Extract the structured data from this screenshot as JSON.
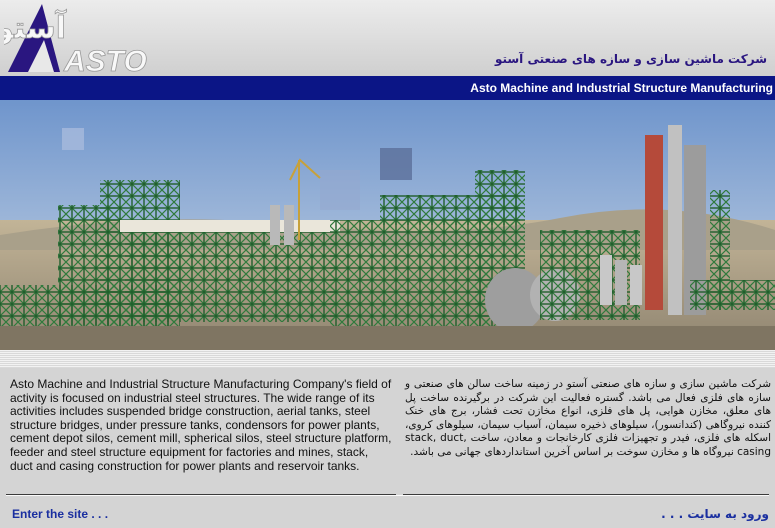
{
  "header": {
    "logo_text_fa": "آستو",
    "logo_text_en": "ASTO",
    "title_fa": "شرکت ماشین سازی و سازه های صنعتی آستو",
    "title_en": "Asto Machine and Industrial Structure Manufacturing"
  },
  "content": {
    "description_en": "Asto Machine and Industrial Structure Manufacturing Company's field of activity is focused on industrial steel structures. The wide range of its activities includes suspended bridge construction, aerial tanks, steel structure bridges, under pressure tanks, condensors for power plants, cement depot silos, cement mill, spherical silos, steel structure platform, feeder and steel structure equipment for factories and mines, stack, duct and casing construction for power plants and reservoir tanks.",
    "description_fa": "شرکت ماشین سازی و سازه های صنعتی آستو در زمینه ساخت سالن های صنعتی و سازه های فلزی فعال می باشد. گستره فعالیت این شرکت در برگیرنده ساخت پل های معلق، مخازن هوایی، پل های فلزی، انواع مخازن تحت فشار، برج های خنک کننده نیروگاهی (کندانسور)، سیلوهای ذخیره سیمان، آسیاب سیمان، سیلوهای کروی، اسکله های فلزی، فیدر و تجهیزات فلزی کارخانجات و معادن، ساخت stack, duct, casing نیروگاه ها و مخازن سوخت بر اساس آخرین استانداردهای جهانی می باشد."
  },
  "footer": {
    "enter_en": "Enter the site . . .",
    "enter_fa": "ورود به سایت . . ."
  },
  "colors": {
    "brand_navy": "#0b1586",
    "title_purple": "#2a1680",
    "link_blue": "#1a2fa0"
  }
}
